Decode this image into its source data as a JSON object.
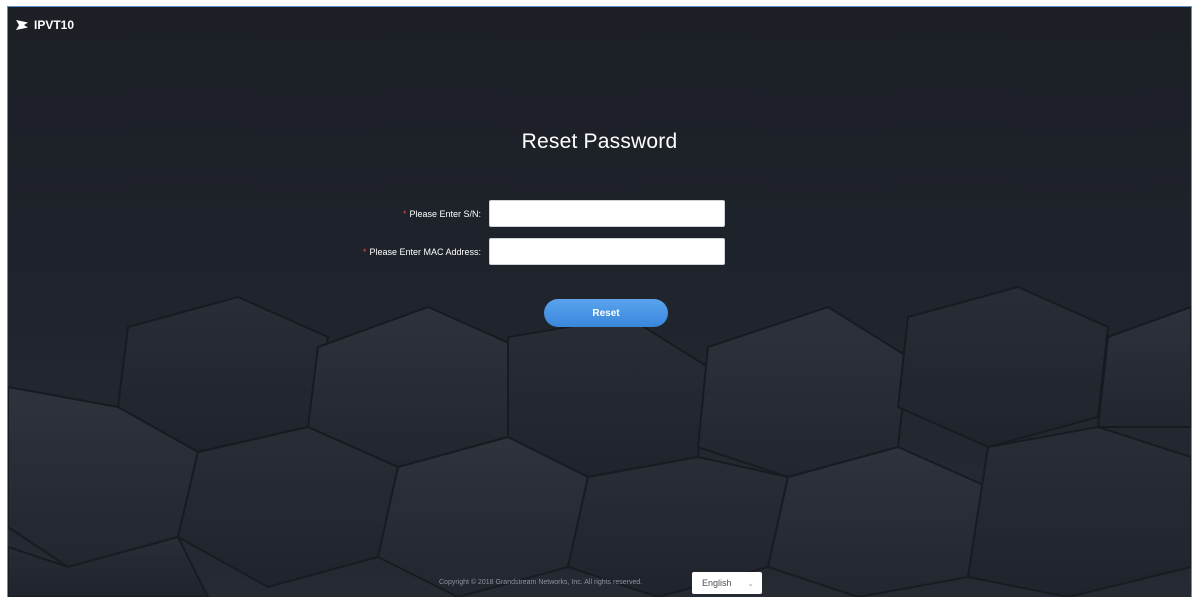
{
  "app": {
    "name": "IPVT10"
  },
  "form": {
    "title": "Reset Password",
    "required_mark": "*",
    "sn_label": "Please Enter S/N:",
    "sn_value": "",
    "mac_label": "Please Enter MAC Address:",
    "mac_value": "",
    "reset_label": "Reset"
  },
  "footer": {
    "copyright": "Copyright © 2018 Grandstream Networks, Inc. All rights reserved.",
    "language": "English"
  },
  "colors": {
    "background": "#1e222a",
    "accent": "#3a86dc",
    "required": "#e3493b"
  },
  "icons": {
    "brand": "grandstream-logo-icon",
    "dropdown": "chevron-down-icon"
  }
}
